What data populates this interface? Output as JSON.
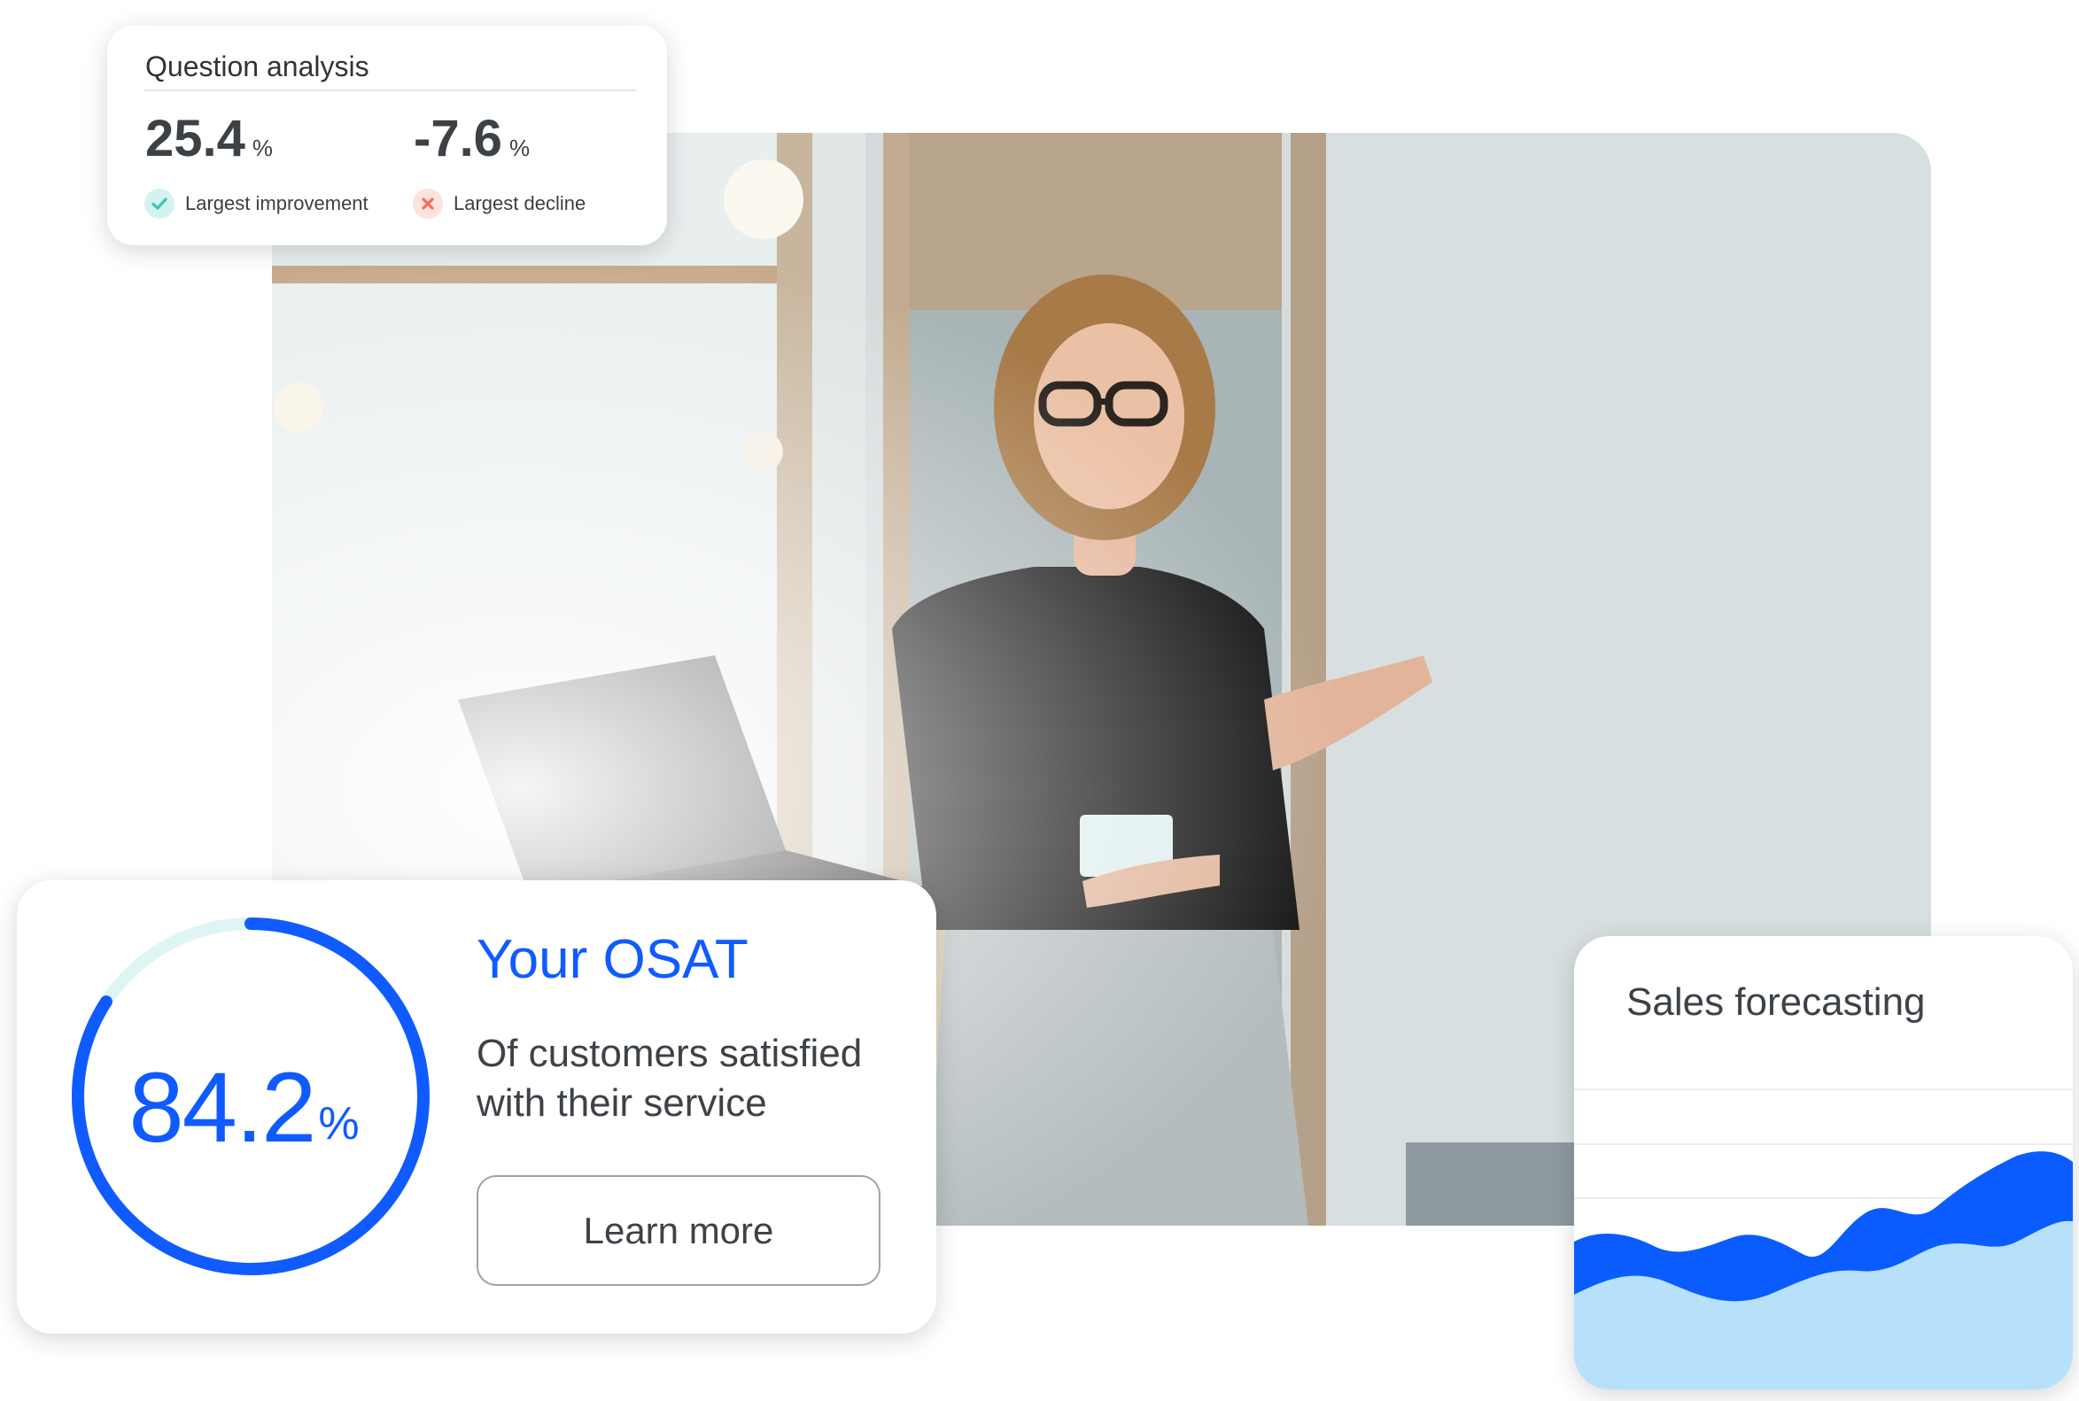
{
  "question_analysis": {
    "title": "Question analysis",
    "improvement": {
      "value": "25.4",
      "unit": "%",
      "label": "Largest improvement",
      "icon": "check-icon",
      "color": "#4fd1c5"
    },
    "decline": {
      "value": "-7.6",
      "unit": "%",
      "label": "Largest decline",
      "icon": "x-icon",
      "color": "#f26d5b"
    }
  },
  "osat": {
    "value": "84.2",
    "unit": "%",
    "progress_fraction": 0.842,
    "title": "Your OSAT",
    "description": "Of customers satisfied with their service",
    "button_label": "Learn more",
    "accent": "#0f5bff",
    "track_color": "#dff5f3"
  },
  "sales_forecasting": {
    "title": "Sales forecasting",
    "colors": {
      "line": "#0a5cff",
      "area": "#b7e1fb",
      "grid": "#ebecee"
    }
  },
  "photo": {
    "icon": "presenter-photo"
  }
}
